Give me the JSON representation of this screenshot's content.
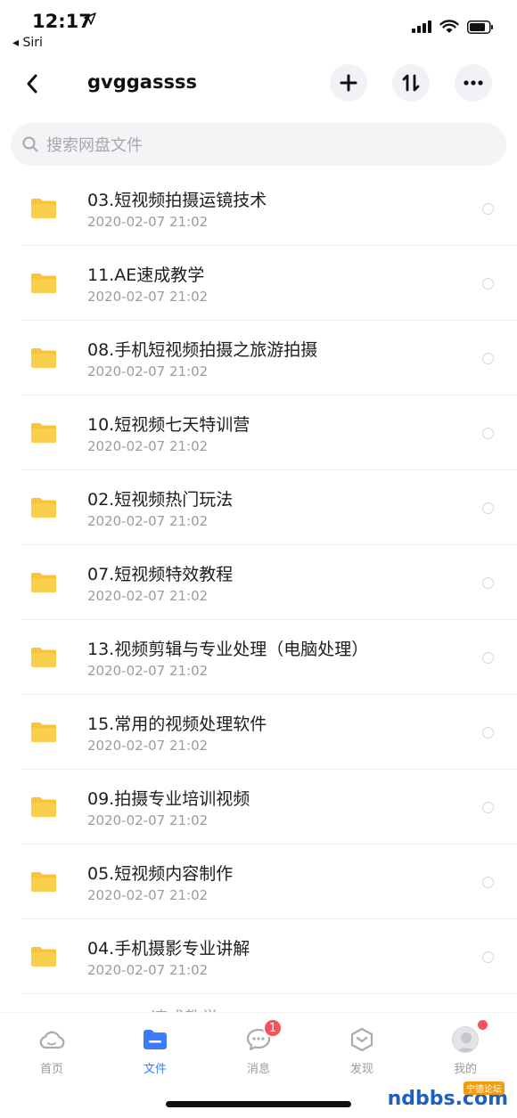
{
  "status": {
    "time": "12:17",
    "back_app": "◂ Siri"
  },
  "header": {
    "title": "gvggassss"
  },
  "search": {
    "placeholder": "搜索网盘文件"
  },
  "files": [
    {
      "name": "03.短视频拍摄运镜技术",
      "date": "2020-02-07 21:02"
    },
    {
      "name": "11.AE速成教学",
      "date": "2020-02-07 21:02"
    },
    {
      "name": "08.手机短视频拍摄之旅游拍摄",
      "date": "2020-02-07 21:02"
    },
    {
      "name": "10.短视频七天特训营",
      "date": "2020-02-07 21:02"
    },
    {
      "name": "02.短视频热门玩法",
      "date": "2020-02-07 21:02"
    },
    {
      "name": "07.短视频特效教程",
      "date": "2020-02-07 21:02"
    },
    {
      "name": "13.视频剪辑与专业处理（电脑处理）",
      "date": "2020-02-07 21:02"
    },
    {
      "name": "15.常用的视频处理软件",
      "date": "2020-02-07 21:02"
    },
    {
      "name": "09.拍摄专业培训视频",
      "date": "2020-02-07 21:02"
    },
    {
      "name": "05.短视频内容制作",
      "date": "2020-02-07 21:02"
    },
    {
      "name": "04.手机摄影专业讲解",
      "date": "2020-02-07 21:02"
    }
  ],
  "partial_row_text": "…速成教学",
  "tabs": [
    {
      "label": "首页",
      "icon": "cloud-icon"
    },
    {
      "label": "文件",
      "icon": "folder-icon"
    },
    {
      "label": "消息",
      "icon": "chat-icon",
      "badge": "1"
    },
    {
      "label": "发现",
      "icon": "discover-icon"
    },
    {
      "label": "我的",
      "icon": "avatar"
    }
  ],
  "active_tab": "文件",
  "watermark": {
    "text": "ndbbs.com",
    "tag": "宁德论坛"
  },
  "colors": {
    "accent": "#3a7cff",
    "folder": "#f8c23a",
    "badge": "#f2545b"
  }
}
